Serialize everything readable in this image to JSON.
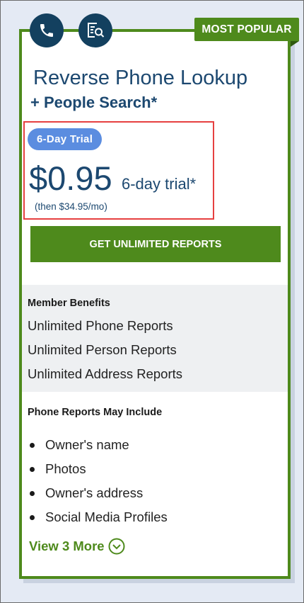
{
  "plan": {
    "badge": "MOST POPULAR",
    "title": "Reverse Phone Lookup",
    "subtitle": "+ People Search*",
    "trial_badge": "6-Day Trial",
    "price": "$0.95",
    "price_suffix": "6-day trial*",
    "then_price": "(then $34.95/mo)",
    "cta_label": "GET UNLIMITED REPORTS"
  },
  "icons": {
    "left": "phone-icon",
    "right": "search-document-icon",
    "view_more": "chevron-down-circle-icon"
  },
  "benefits": {
    "heading": "Member Benefits",
    "items": [
      "Unlimited Phone Reports",
      "Unlimited Person Reports",
      "Unlimited Address Reports"
    ]
  },
  "includes": {
    "heading": "Phone Reports May Include",
    "items": [
      "Owner's name",
      "Photos",
      "Owner's address",
      "Social Media Profiles"
    ],
    "view_more": "View 3 More"
  },
  "colors": {
    "brand_green": "#4e8a1c",
    "navy": "#13405f",
    "heading_blue": "#1c4870",
    "trial_blue": "#5b8de0",
    "highlight_red": "#e64040",
    "page_bg": "#e4eaf4"
  }
}
